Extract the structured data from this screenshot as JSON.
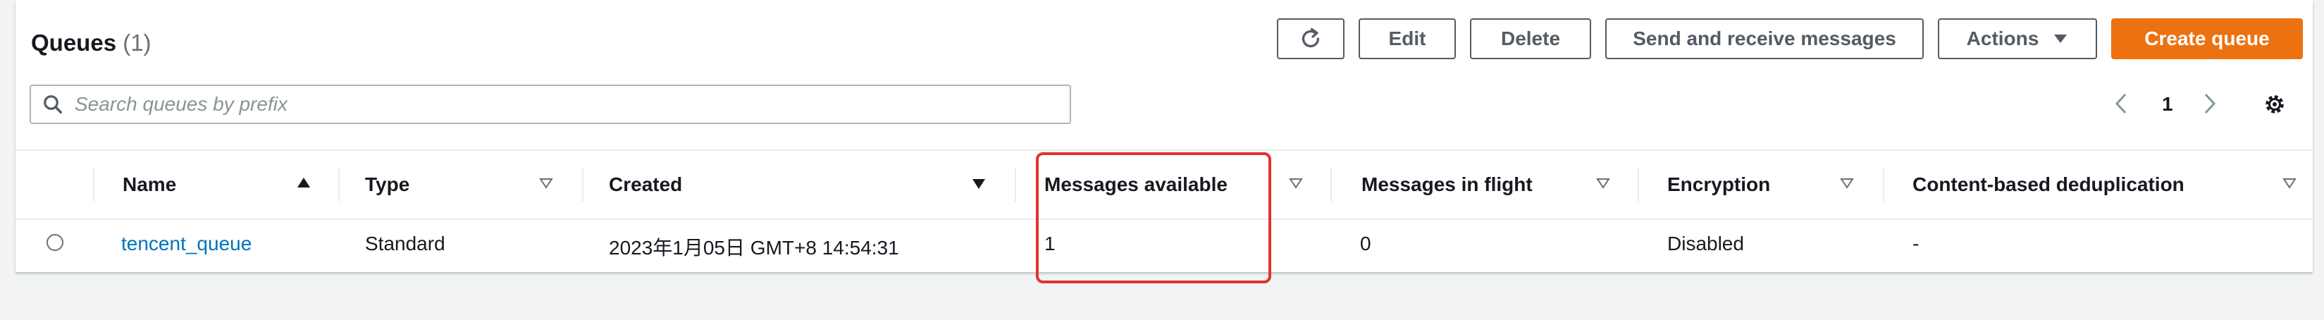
{
  "header": {
    "title": "Queues",
    "count": "(1)"
  },
  "toolbar": {
    "edit_label": "Edit",
    "delete_label": "Delete",
    "send_receive_label": "Send and receive messages",
    "actions_label": "Actions",
    "create_label": "Create queue"
  },
  "search": {
    "placeholder": "Search queues by prefix"
  },
  "pagination": {
    "current_page": "1"
  },
  "table": {
    "columns": [
      {
        "label": "Name",
        "sort": "ascending"
      },
      {
        "label": "Type"
      },
      {
        "label": "Created"
      },
      {
        "label": "Messages available"
      },
      {
        "label": "Messages in flight"
      },
      {
        "label": "Encryption"
      },
      {
        "label": "Content-based deduplication"
      }
    ],
    "rows": [
      {
        "name": "tencent_queue",
        "type": "Standard",
        "created": "2023年1月05日 GMT+8 14:54:31",
        "messages_available": "1",
        "messages_in_flight": "0",
        "encryption": "Disabled",
        "deduplication": "-"
      }
    ]
  },
  "colors": {
    "primary_button": "#ec7211",
    "link": "#0073bb",
    "annotation": "#e0332f"
  },
  "icons": [
    "refresh-icon",
    "caret-down-icon",
    "search-icon",
    "chevron-left-icon",
    "chevron-right-icon",
    "settings-icon",
    "sort-ascending-icon",
    "sort-descending-icon",
    "sort-unsorted-icon"
  ]
}
